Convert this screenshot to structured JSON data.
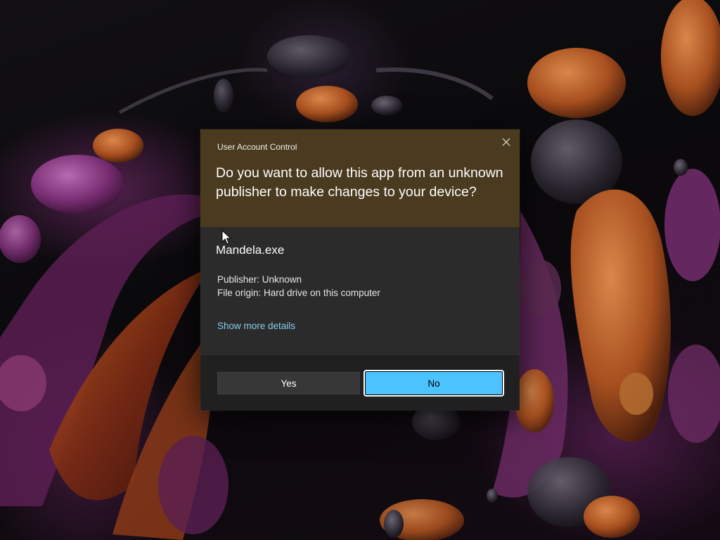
{
  "dialog": {
    "title": "User Account Control",
    "question": "Do you want to allow this app from an unknown publisher to make changes to your device?",
    "app_name": "Mandela.exe",
    "publisher": "Publisher: Unknown",
    "file_origin": "File origin: Hard drive on this computer",
    "details_link": "Show more details",
    "yes_label": "Yes",
    "no_label": "No",
    "close_icon": "close-icon",
    "colors": {
      "header": "#4a3a1f",
      "body": "#2b2b2b",
      "footer": "#202020",
      "link": "#88ccee",
      "accent_button": "#4cc2ff"
    }
  }
}
